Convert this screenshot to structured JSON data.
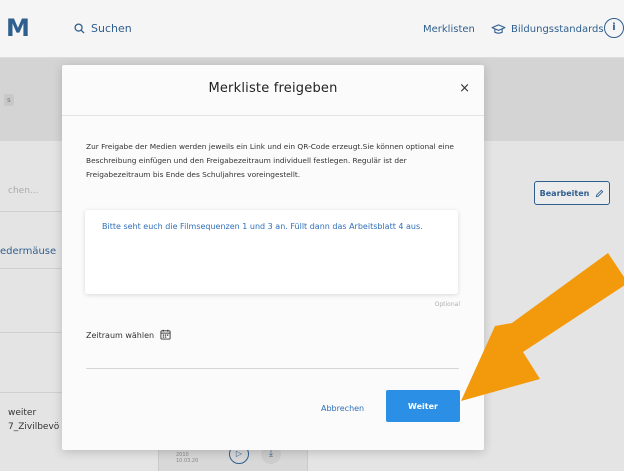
{
  "topbar": {
    "logo": "M",
    "search_label": "Suchen",
    "merklisten_label": "Merklisten",
    "bildungsstandards_label": "Bildungsstandards",
    "info_label": "i"
  },
  "background": {
    "chip_text": "s",
    "search_placeholder_partial": "chen...",
    "list_item_partial": "edermäuse",
    "bottom_item_line1": "weiter",
    "bottom_item_line2": "7_Zivilbevö",
    "bearbeiten_label": "Bearbeiten",
    "media_date_line1": "2010",
    "media_date_line2": "10.03.20"
  },
  "dialog": {
    "title": "Merkliste freigeben",
    "close_symbol": "×",
    "description": "Zur Freigabe der Medien werden jeweils ein Link und ein QR-Code erzeugt.Sie können optional eine Beschreibung einfügen und den Freigabezeitraum individuell festlegen. Regulär ist der Freigabezeitraum bis Ende des Schuljahres voreingestellt.",
    "message_text": "Bitte seht euch die Filmsequenzen 1 und 3 an. Füllt dann das Arbeitsblatt 4 aus.",
    "optional_label": "Optional",
    "zeitraum_label": "Zeitraum wählen",
    "cancel_label": "Abbrechen",
    "next_label": "Weiter"
  },
  "colors": {
    "brand_blue": "#2f5f8f",
    "link_blue": "#2f6fb8",
    "primary_button": "#2b8fe6",
    "annotation_arrow": "#f39a0c"
  },
  "icons": [
    "search-icon",
    "graduation-cap-icon",
    "info-icon",
    "close-icon",
    "calendar-icon",
    "pencil-icon",
    "play-icon",
    "download-icon",
    "annotation-arrow"
  ]
}
